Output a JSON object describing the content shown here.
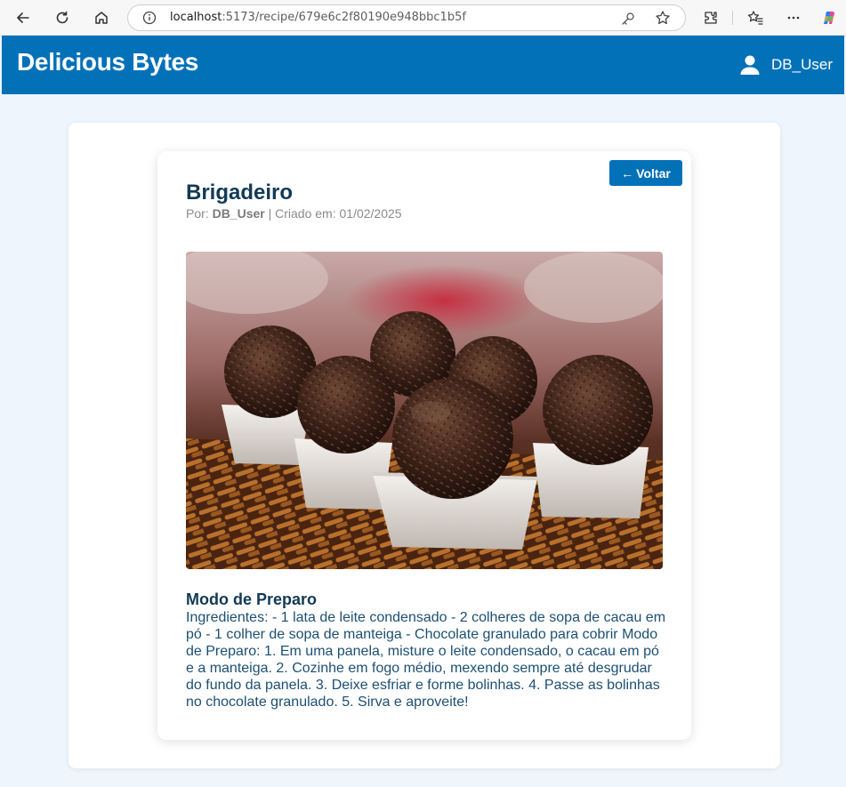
{
  "browser": {
    "url_host": "localhost",
    "url_path": ":5173/recipe/679e6c2f80190e948bbc1b5f"
  },
  "header": {
    "brand": "Delicious Bytes",
    "username": "DB_User"
  },
  "recipe": {
    "back_label": "Voltar",
    "title": "Brigadeiro",
    "meta_prefix": "Por:",
    "author": "DB_User",
    "meta_separator": "| Criado em:",
    "created_date": "01/02/2025",
    "section_title": "Modo de Preparo",
    "instructions": "Ingredientes: - 1 lata de leite condensado - 2 colheres de sopa de cacau em pó - 1 colher de sopa de manteiga - Chocolate granulado para cobrir Modo de Preparo: 1. Em uma panela, misture o leite condensado, o cacau em pó e a manteiga. 2. Cozinhe em fogo médio, mexendo sempre até desgrudar do fundo da panela. 3. Deixe esfriar e forme bolinhas. 4. Passe as bolinhas no chocolate granulado. 5. Sirva e aproveite!"
  },
  "colors": {
    "primary": "#0271b8",
    "title": "#123a55",
    "background": "#eef5fc"
  }
}
